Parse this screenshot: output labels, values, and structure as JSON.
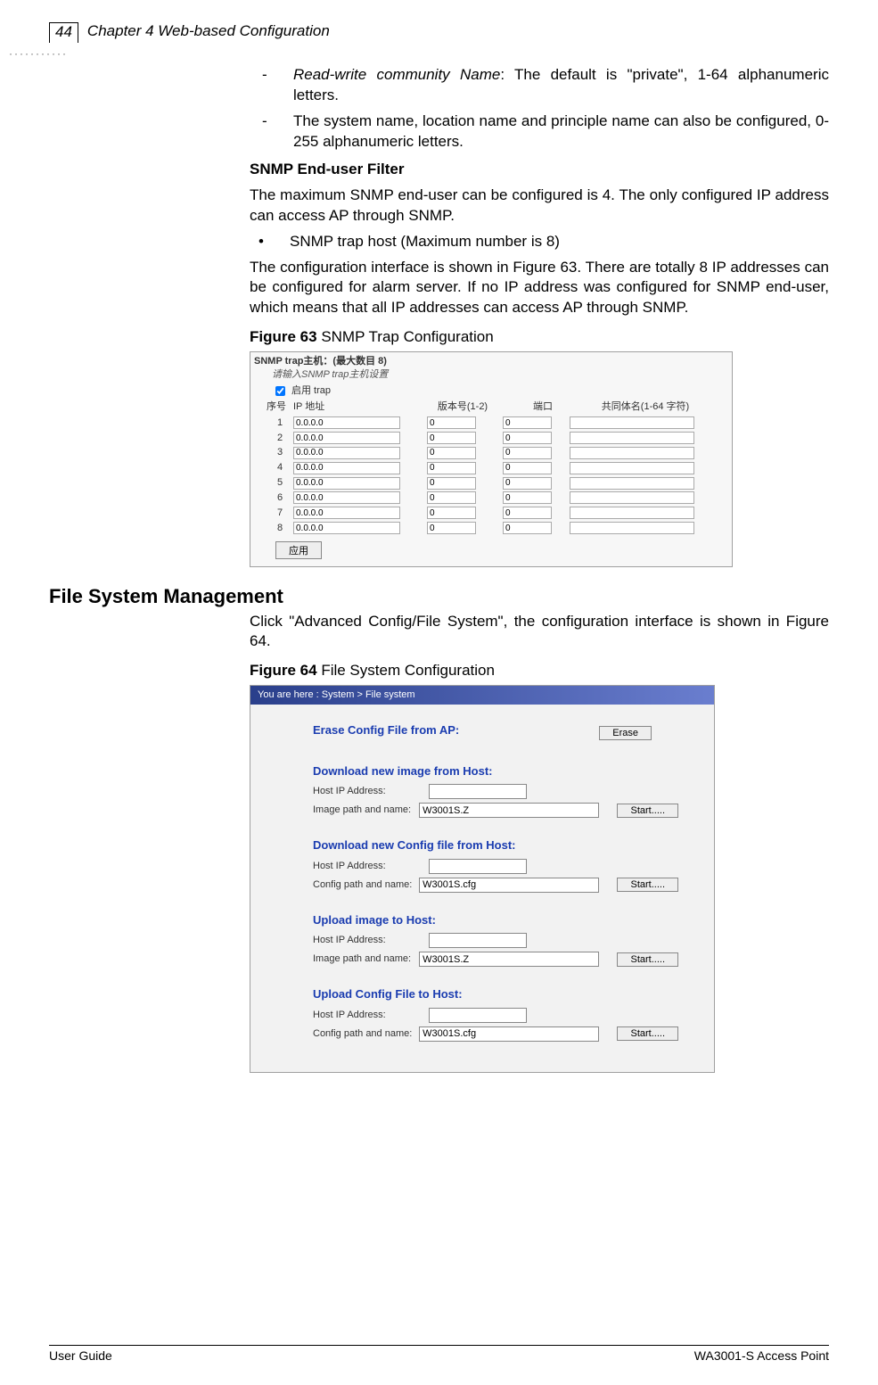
{
  "header": {
    "page_number": "44",
    "chapter_title": "Chapter 4 Web-based Configuration"
  },
  "body": {
    "dash1_prefix": "Read-write community Name",
    "dash1_rest": ": The default is \"private\", 1-64 alphanumeric letters.",
    "dash2": "The system name, location name and principle name can also be configured, 0-255 alphanumeric letters.",
    "snmp_filter_heading": "SNMP End-user Filter",
    "snmp_filter_para": "The maximum SNMP end-user can be configured is 4. The only configured IP address can access AP through SNMP.",
    "bullet_trap": "SNMP trap host (Maximum number is 8)",
    "trap_para": "The configuration interface is shown in Figure 63. There are totally 8 IP addresses can be configured for alarm server. If no IP address was configured for SNMP end-user, which means that all IP addresses can access AP through SNMP.",
    "fig63_caption_bold": "Figure 63",
    "fig63_caption_rest": " SNMP Trap Configuration",
    "section_heading": "File System Management",
    "fsm_para": "Click \"Advanced Config/File System\", the configuration interface is shown in Figure 64.",
    "fig64_caption_bold": "Figure 64",
    "fig64_caption_rest": " File System Configuration"
  },
  "fig63": {
    "title": "SNMP trap主机：(最大数目  8)",
    "subtitle": "请输入SNMP trap主机设置",
    "enable_label": "启用 trap",
    "col_seq": "序号",
    "col_ip": "IP 地址",
    "col_ver": "版本号(1-2)",
    "col_port": "端口",
    "col_comm": "共同体名(1-64 字符)",
    "rows": [
      {
        "n": "1",
        "ip": "0.0.0.0",
        "ver": "0",
        "port": "0",
        "comm": ""
      },
      {
        "n": "2",
        "ip": "0.0.0.0",
        "ver": "0",
        "port": "0",
        "comm": ""
      },
      {
        "n": "3",
        "ip": "0.0.0.0",
        "ver": "0",
        "port": "0",
        "comm": ""
      },
      {
        "n": "4",
        "ip": "0.0.0.0",
        "ver": "0",
        "port": "0",
        "comm": ""
      },
      {
        "n": "5",
        "ip": "0.0.0.0",
        "ver": "0",
        "port": "0",
        "comm": ""
      },
      {
        "n": "6",
        "ip": "0.0.0.0",
        "ver": "0",
        "port": "0",
        "comm": ""
      },
      {
        "n": "7",
        "ip": "0.0.0.0",
        "ver": "0",
        "port": "0",
        "comm": ""
      },
      {
        "n": "8",
        "ip": "0.0.0.0",
        "ver": "0",
        "port": "0",
        "comm": ""
      }
    ],
    "apply": "应用"
  },
  "fig64": {
    "breadcrumb": "You are here : System > File system",
    "erase_heading": "Erase Config File from AP:",
    "erase_btn": "Erase",
    "dl_image_heading": "Download new image from Host:",
    "dl_config_heading": "Download new Config file from Host:",
    "ul_image_heading": "Upload image to Host:",
    "ul_config_heading": "Upload Config File to Host:",
    "host_ip_label": "Host IP Address:",
    "image_path_label": "Image path and name:",
    "config_path_label": "Config path and name:",
    "image_path_value": "W3001S.Z",
    "config_path_value": "W3001S.cfg",
    "start_btn": "Start....."
  },
  "footer": {
    "left": "User Guide",
    "right": "WA3001-S Access Point"
  }
}
